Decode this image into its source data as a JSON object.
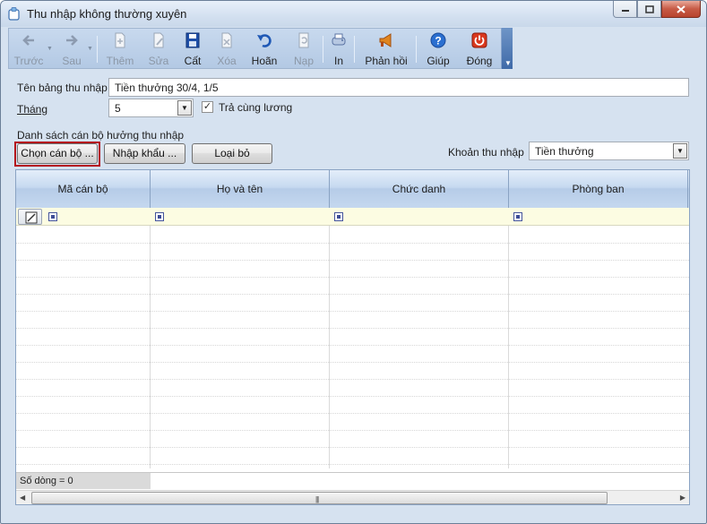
{
  "window": {
    "title": "Thu nhập không thường xuyên"
  },
  "toolbar": {
    "items": [
      {
        "label": "Trước",
        "icon": "arrow-left-icon",
        "enabled": false
      },
      {
        "label": "Sau",
        "icon": "arrow-right-icon",
        "enabled": false
      },
      {
        "label": "Thêm",
        "icon": "add-document-icon",
        "enabled": false
      },
      {
        "label": "Sửa",
        "icon": "edit-document-icon",
        "enabled": false
      },
      {
        "label": "Cất",
        "icon": "save-icon",
        "enabled": true
      },
      {
        "label": "Xóa",
        "icon": "delete-document-icon",
        "enabled": false
      },
      {
        "label": "Hoãn",
        "icon": "undo-icon",
        "enabled": true
      },
      {
        "label": "Nạp",
        "icon": "reload-icon",
        "enabled": false
      },
      {
        "label": "In",
        "icon": "print-icon",
        "enabled": true
      },
      {
        "label": "Phản hồi",
        "icon": "megaphone-icon",
        "enabled": true
      },
      {
        "label": "Giúp",
        "icon": "help-icon",
        "enabled": true
      },
      {
        "label": "Đóng",
        "icon": "power-icon",
        "enabled": true
      }
    ]
  },
  "form": {
    "table_name_label": "Tên bảng thu nhập",
    "table_name_value": "Tiền thưởng 30/4, 1/5",
    "month_label": "Tháng",
    "month_value": "5",
    "pay_with_salary_label": "Trả cùng lương",
    "pay_with_salary_checked": true,
    "employee_list_label": "Danh sách cán bộ hưởng thu nhập",
    "select_employee_button": "Chọn cán bộ ...",
    "import_button": "Nhập khẩu ...",
    "remove_button": "Loại bỏ",
    "income_item_label": "Khoản thu nhập",
    "income_item_value": "Tiền thưởng"
  },
  "grid": {
    "columns": [
      "Mã cán bộ",
      "Họ và tên",
      "Chức danh",
      "Phòng ban"
    ],
    "rows": [],
    "footer_count": "Số dòng = 0"
  },
  "colors": {
    "window_bg": "#d6e2f0",
    "highlight_border": "#b40f1a",
    "new_row_bg": "#fcfce2",
    "header_blue": "#c6d9f0"
  }
}
